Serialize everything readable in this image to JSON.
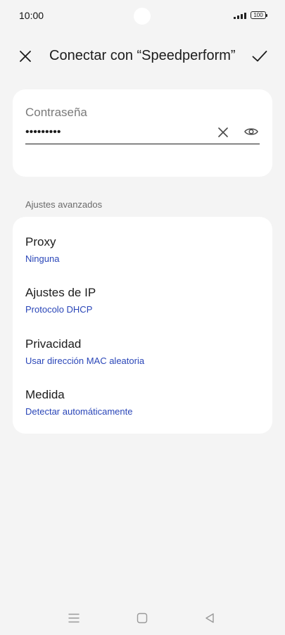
{
  "status_bar": {
    "time": "10:00",
    "battery": "100",
    "icons": [
      "signal-icon",
      "battery-icon"
    ]
  },
  "header": {
    "title": "Conectar con “Speedperform”",
    "close_icon": "close-icon",
    "confirm_icon": "check-icon"
  },
  "password": {
    "label": "Contraseña",
    "value": "•••••••••",
    "clear_icon": "clear-icon",
    "visibility_icon": "eye-icon"
  },
  "advanced": {
    "section_label": "Ajustes avanzados",
    "items": [
      {
        "title": "Proxy",
        "value": "Ninguna"
      },
      {
        "title": "Ajustes de IP",
        "value": "Protocolo DHCP"
      },
      {
        "title": "Privacidad",
        "value": "Usar dirección MAC aleatoria"
      },
      {
        "title": "Medida",
        "value": "Detectar automáticamente"
      }
    ]
  },
  "navigation": {
    "icons": [
      "menu-icon",
      "home-icon",
      "back-icon"
    ]
  },
  "colors": {
    "background": "#f4f4f4",
    "card": "#ffffff",
    "accent": "#2a46b8",
    "text": "#1c1c1c"
  }
}
